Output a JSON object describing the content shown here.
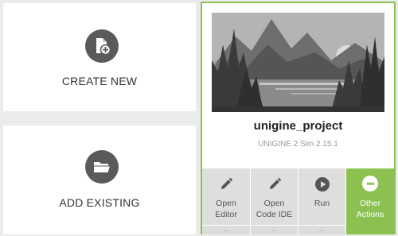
{
  "actions": {
    "create_new": {
      "label": "CREATE NEW",
      "icon": "new-file-plus-icon"
    },
    "add_existing": {
      "label": "ADD EXISTING",
      "icon": "open-folder-icon"
    }
  },
  "project": {
    "name": "unigine_project",
    "sdk": "UNIGINE 2 Sim 2.15.1",
    "thumbnail": "mountain-lake-landscape",
    "accent_color": "#8cc152"
  },
  "toolbar": {
    "open_editor": {
      "line1": "Open",
      "line2": "Editor",
      "more": "...",
      "icon": "pencil-icon"
    },
    "open_code_ide": {
      "line1": "Open",
      "line2": "Code IDE",
      "more": "...",
      "icon": "pencil-icon"
    },
    "run": {
      "line1": "Run",
      "more": "...",
      "icon": "play-icon"
    },
    "other_actions": {
      "line1": "Other",
      "line2": "Actions",
      "icon": "more-dots-icon",
      "dots": "•••"
    }
  }
}
